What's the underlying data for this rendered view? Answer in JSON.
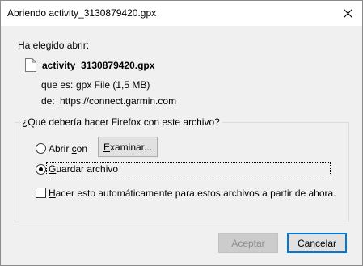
{
  "window": {
    "title": "Abriendo activity_3130879420.gpx"
  },
  "intro": {
    "heading": "Ha elegido abrir:",
    "file_name": "activity_3130879420.gpx",
    "type_label": "que es:",
    "type_value": "gpx File (1,5 MB)",
    "from_label": "de:",
    "from_value": "https://connect.garmin.com"
  },
  "action_group": {
    "title": "¿Qué debería hacer Firefox con este archivo?",
    "open_with": {
      "label_pre": "Abrir ",
      "label_acc": "c",
      "label_post": "on",
      "selected": false
    },
    "browse_button": {
      "label_acc": "E",
      "label_rest": "xaminar..."
    },
    "save_file": {
      "label_acc": "G",
      "label_rest": "uardar archivo",
      "selected": true
    },
    "auto_checkbox": {
      "label_acc": "H",
      "label_rest": "acer esto automáticamente para estos archivos a partir de ahora.",
      "checked": false
    }
  },
  "footer": {
    "accept_label": "Aceptar",
    "cancel_label": "Cancelar"
  },
  "icons": {
    "close": "close-icon",
    "file": "file-icon"
  },
  "colors": {
    "dialog_bg": "#f0f0f0",
    "default_button_border": "#0078d7"
  }
}
